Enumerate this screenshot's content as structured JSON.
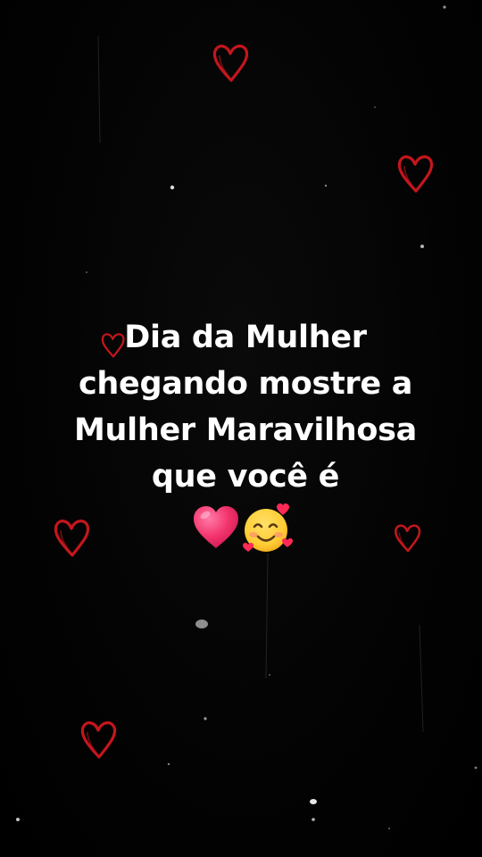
{
  "caption": {
    "lines": [
      "Dia da Mulher",
      "chegando mostre a",
      "Mulher Maravilhosa",
      "que você é"
    ]
  },
  "emojis": [
    "pink-heart",
    "smiling-face-with-hearts"
  ],
  "colors": {
    "background": "#000000",
    "text": "#ffffff",
    "doodle_heart": "#c4161c",
    "pink_heart": "#f2336b",
    "emoji_face": "#ffcc33"
  }
}
